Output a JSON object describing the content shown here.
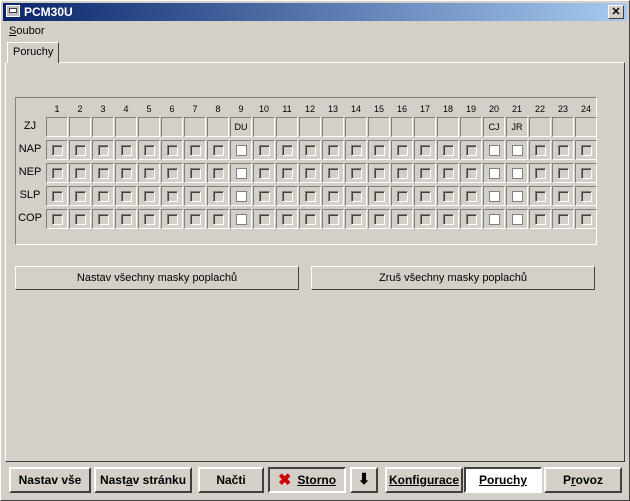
{
  "window": {
    "title": "PCM30U",
    "close_label": "✕"
  },
  "menu": {
    "soubor_first": "S",
    "soubor_rest": "oubor"
  },
  "tabs": [
    {
      "label": "Poruchy"
    }
  ],
  "grid": {
    "columns": [
      "1",
      "2",
      "3",
      "4",
      "5",
      "6",
      "7",
      "8",
      "9",
      "10",
      "11",
      "12",
      "13",
      "14",
      "15",
      "16",
      "17",
      "18",
      "19",
      "20",
      "21",
      "22",
      "23",
      "24"
    ],
    "zj_label": "ZJ",
    "zj_values": [
      "",
      "",
      "",
      "",
      "",
      "",
      "",
      "",
      "DU",
      "",
      "",
      "",
      "",
      "",
      "",
      "",
      "",
      "",
      "",
      "CJ",
      "JR",
      "",
      "",
      ""
    ],
    "rows": [
      {
        "label": "NAP",
        "checked": [
          9,
          20,
          21
        ]
      },
      {
        "label": "NEP",
        "checked": [
          9,
          20,
          21
        ]
      },
      {
        "label": "SLP",
        "checked": [
          9,
          20,
          21
        ]
      },
      {
        "label": "COP",
        "checked": [
          9,
          20,
          21
        ]
      }
    ]
  },
  "actions": {
    "set_all_masks": "Nastav všechny masky poplachů",
    "clear_all_masks": "Zruš všechny masky poplachů"
  },
  "bottom": {
    "nastav_vse": "Nastav vše",
    "nastav_stranku_a": "Nast",
    "nastav_stranku_u": "a",
    "nastav_stranku_b": "v stránku",
    "nacti": "Načti",
    "storno": "Storno",
    "storno_icon": "✖",
    "down_icon": "⬇",
    "konfigurace": "Konfigurace",
    "poruchy": "Poruchy",
    "provoz_a": "P",
    "provoz_u": "r",
    "provoz_b": "ovoz"
  }
}
